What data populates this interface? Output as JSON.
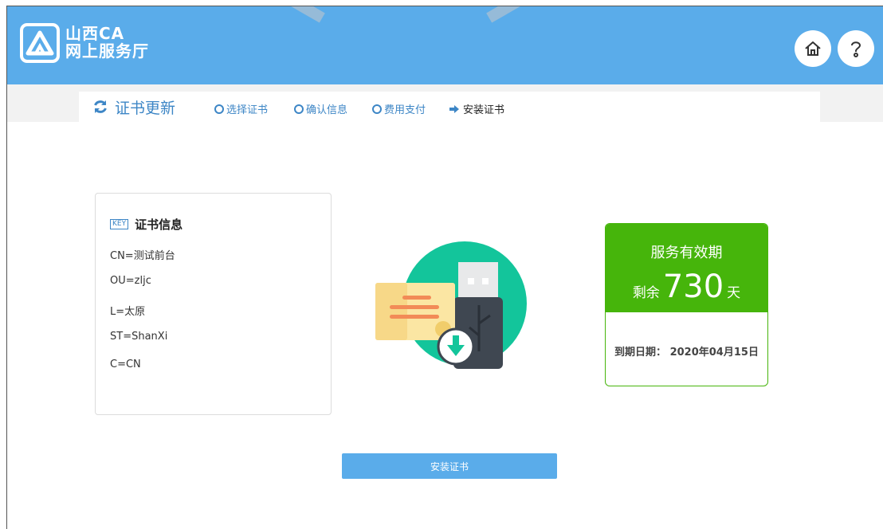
{
  "header": {
    "brand_line1": "山西CA",
    "brand_line2": "网上服务厅",
    "home_icon": "home-icon",
    "help_icon": "help-icon",
    "color": "#5aacea"
  },
  "steps": {
    "title": "证书更新",
    "items": [
      {
        "label": "选择证书",
        "state": "pending"
      },
      {
        "label": "确认信息",
        "state": "pending"
      },
      {
        "label": "费用支付",
        "state": "pending"
      },
      {
        "label": "安装证书",
        "state": "current"
      }
    ]
  },
  "cert": {
    "badge": "KEY",
    "title": "证书信息",
    "lines": [
      "CN=测试前台",
      "OU=zljc",
      "L=太原",
      "ST=ShanXi",
      "C=CN"
    ]
  },
  "validity": {
    "title": "服务有效期",
    "remaining_prefix": "剩余",
    "remaining_days": "730",
    "remaining_suffix": "天",
    "expire_label": "到期日期：",
    "expire_date": "2020年04月15日",
    "color": "#46b50b"
  },
  "actions": {
    "install_label": "安装证书"
  }
}
